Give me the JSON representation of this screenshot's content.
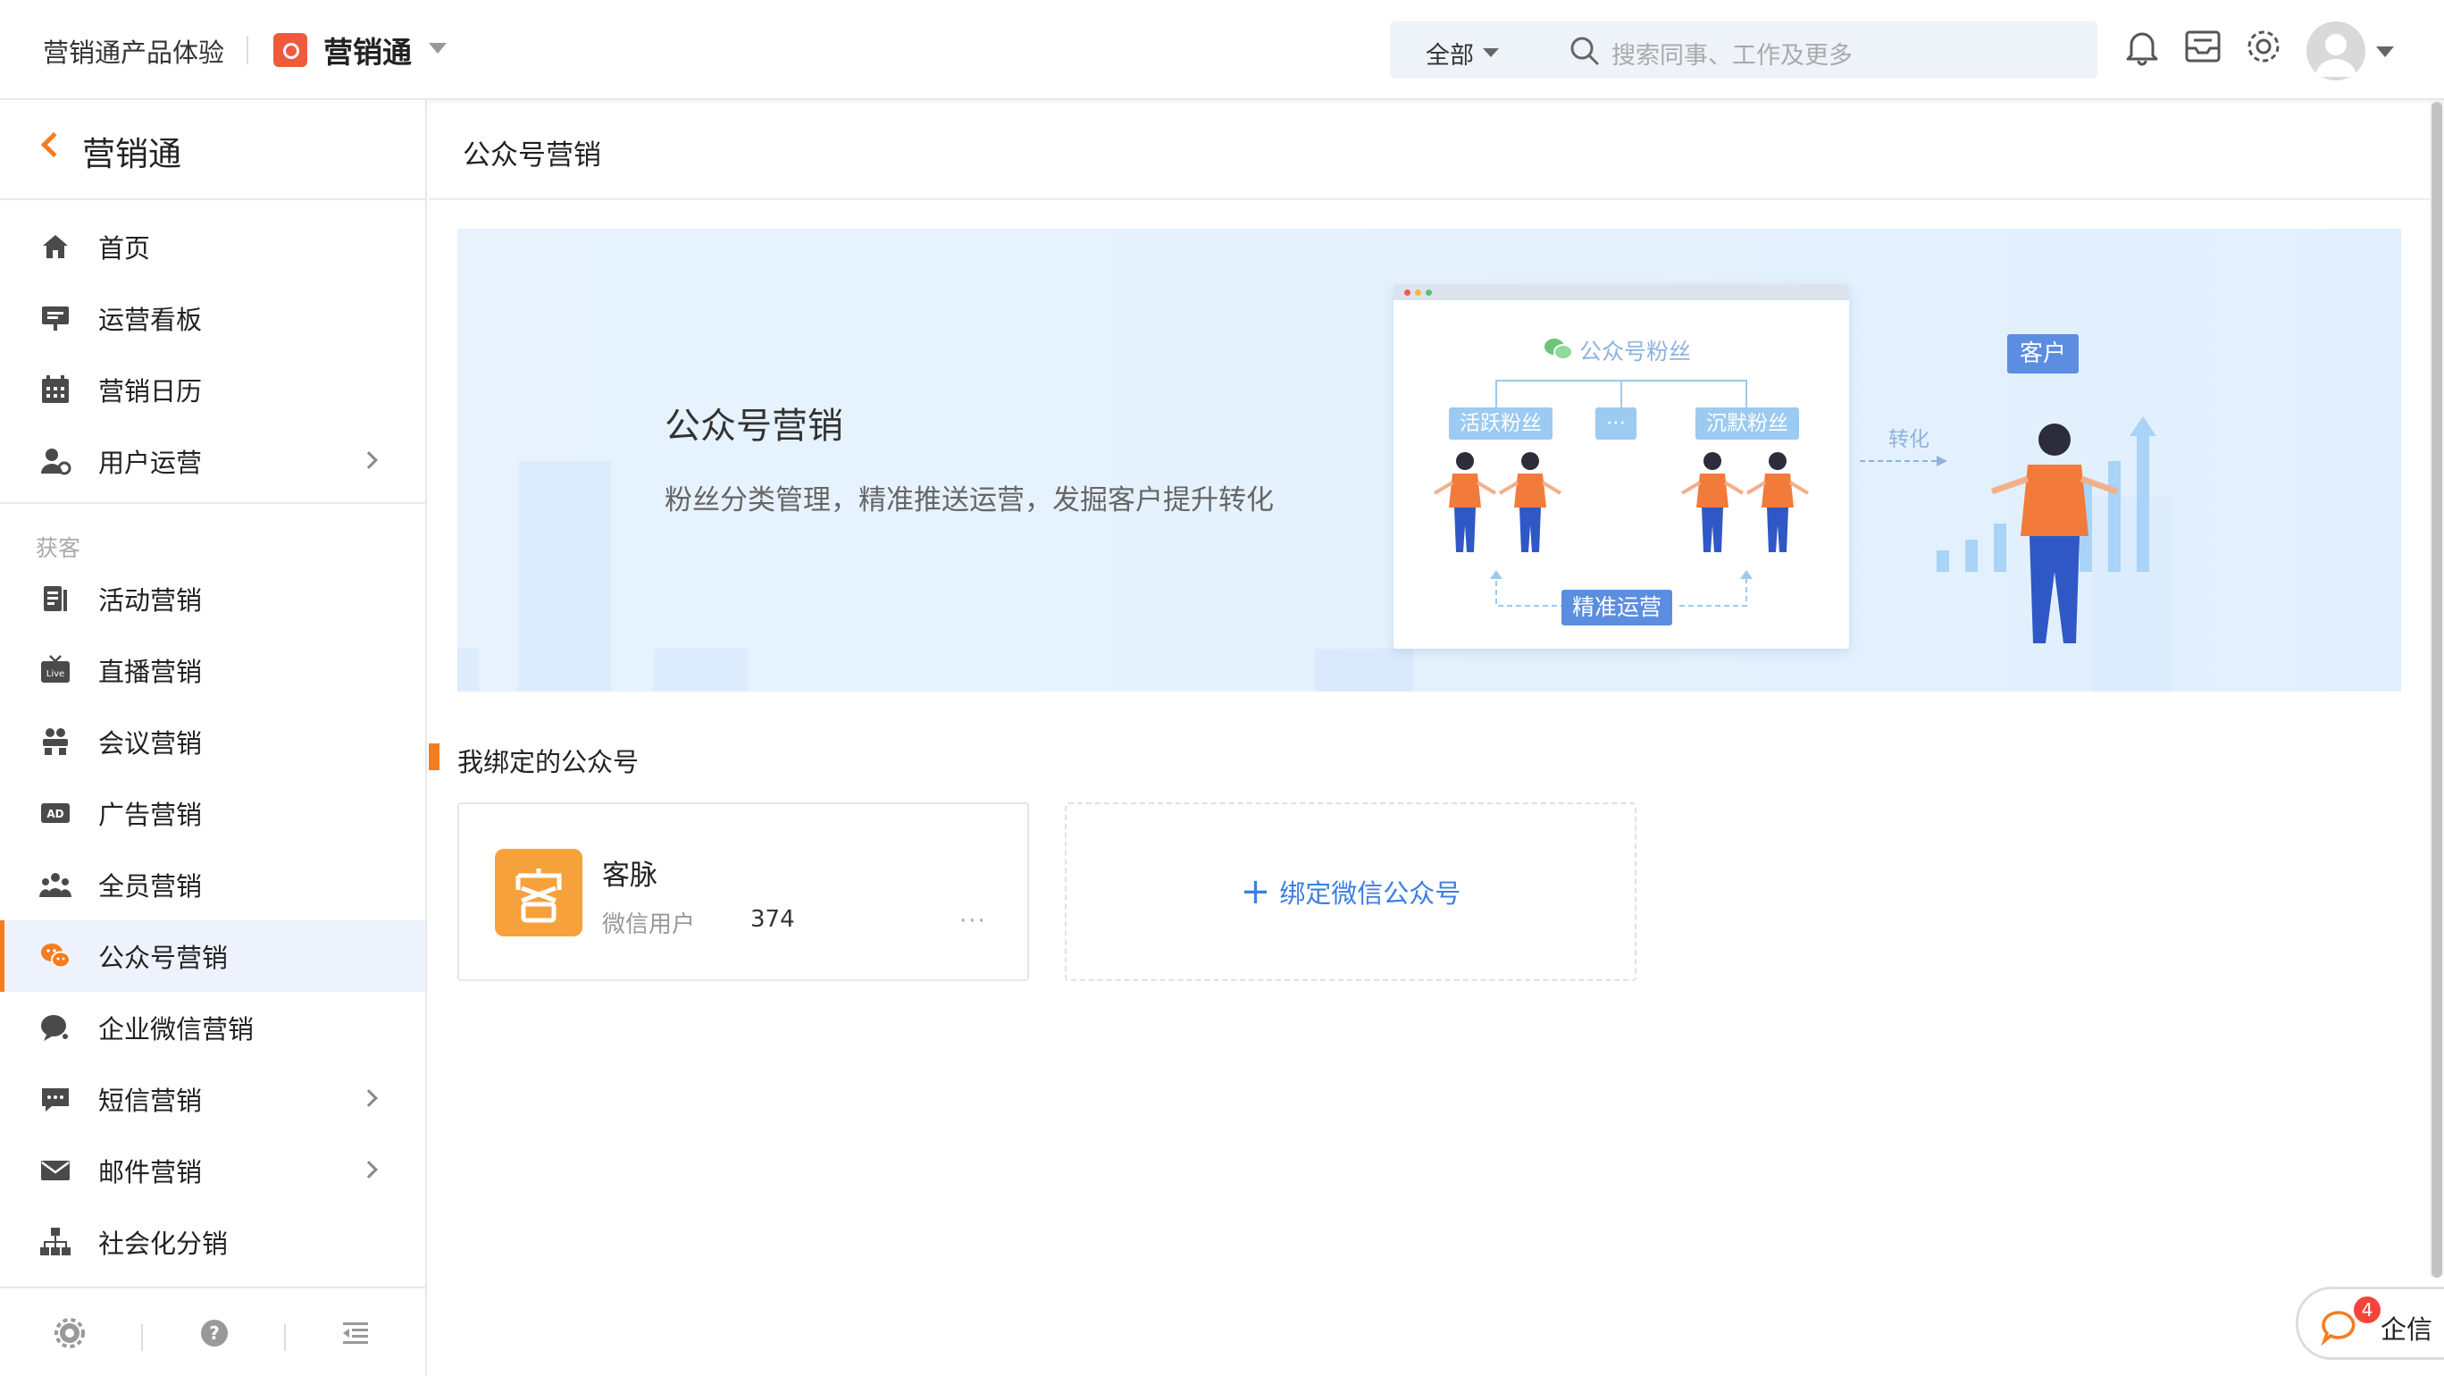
{
  "header": {
    "org_name": "营销通产品体验",
    "app_name": "营销通",
    "search_scope": "全部",
    "search_placeholder": "搜索同事、工作及更多"
  },
  "sidebar": {
    "title": "营销通",
    "top_items": [
      {
        "label": "首页",
        "icon": "home-icon"
      },
      {
        "label": "运营看板",
        "icon": "dashboard-icon"
      },
      {
        "label": "营销日历",
        "icon": "calendar-icon"
      },
      {
        "label": "用户运营",
        "icon": "user-ops-icon",
        "has_submenu": true
      }
    ],
    "section_label": "获客",
    "items": [
      {
        "label": "活动营销",
        "icon": "activity-icon"
      },
      {
        "label": "直播营销",
        "icon": "live-icon"
      },
      {
        "label": "会议营销",
        "icon": "meeting-icon"
      },
      {
        "label": "广告营销",
        "icon": "ad-icon"
      },
      {
        "label": "全员营销",
        "icon": "all-staff-icon"
      },
      {
        "label": "公众号营销",
        "icon": "wechat-icon",
        "active": true
      },
      {
        "label": "企业微信营销",
        "icon": "work-wechat-icon"
      },
      {
        "label": "短信营销",
        "icon": "sms-icon",
        "has_submenu": true
      },
      {
        "label": "邮件营销",
        "icon": "mail-icon",
        "has_submenu": true
      },
      {
        "label": "社会化分销",
        "icon": "distribution-icon"
      }
    ]
  },
  "main": {
    "title": "公众号营销",
    "banner": {
      "title": "公众号营销",
      "subtitle": "粉丝分类管理，精准推送运营，发掘客户提升转化",
      "illustration": {
        "fans_label": "公众号粉丝",
        "active_fans": "活跃粉丝",
        "more": "···",
        "silent_fans": "沉默粉丝",
        "precise_ops": "精准运营",
        "convert": "转化",
        "customer": "客户"
      }
    },
    "bound_section_title": "我绑定的公众号",
    "account_card": {
      "name": "客脉",
      "meta_label": "微信用户",
      "user_count": "374",
      "more": "···"
    },
    "bind_button": "绑定微信公众号"
  },
  "chat_widget": {
    "label": "企信",
    "badge": "4"
  },
  "colors": {
    "accent_orange": "#f57c1f",
    "link_blue": "#3c7fe0",
    "banner_bg": "#e5f1fd",
    "active_bg": "#eef2fc"
  }
}
